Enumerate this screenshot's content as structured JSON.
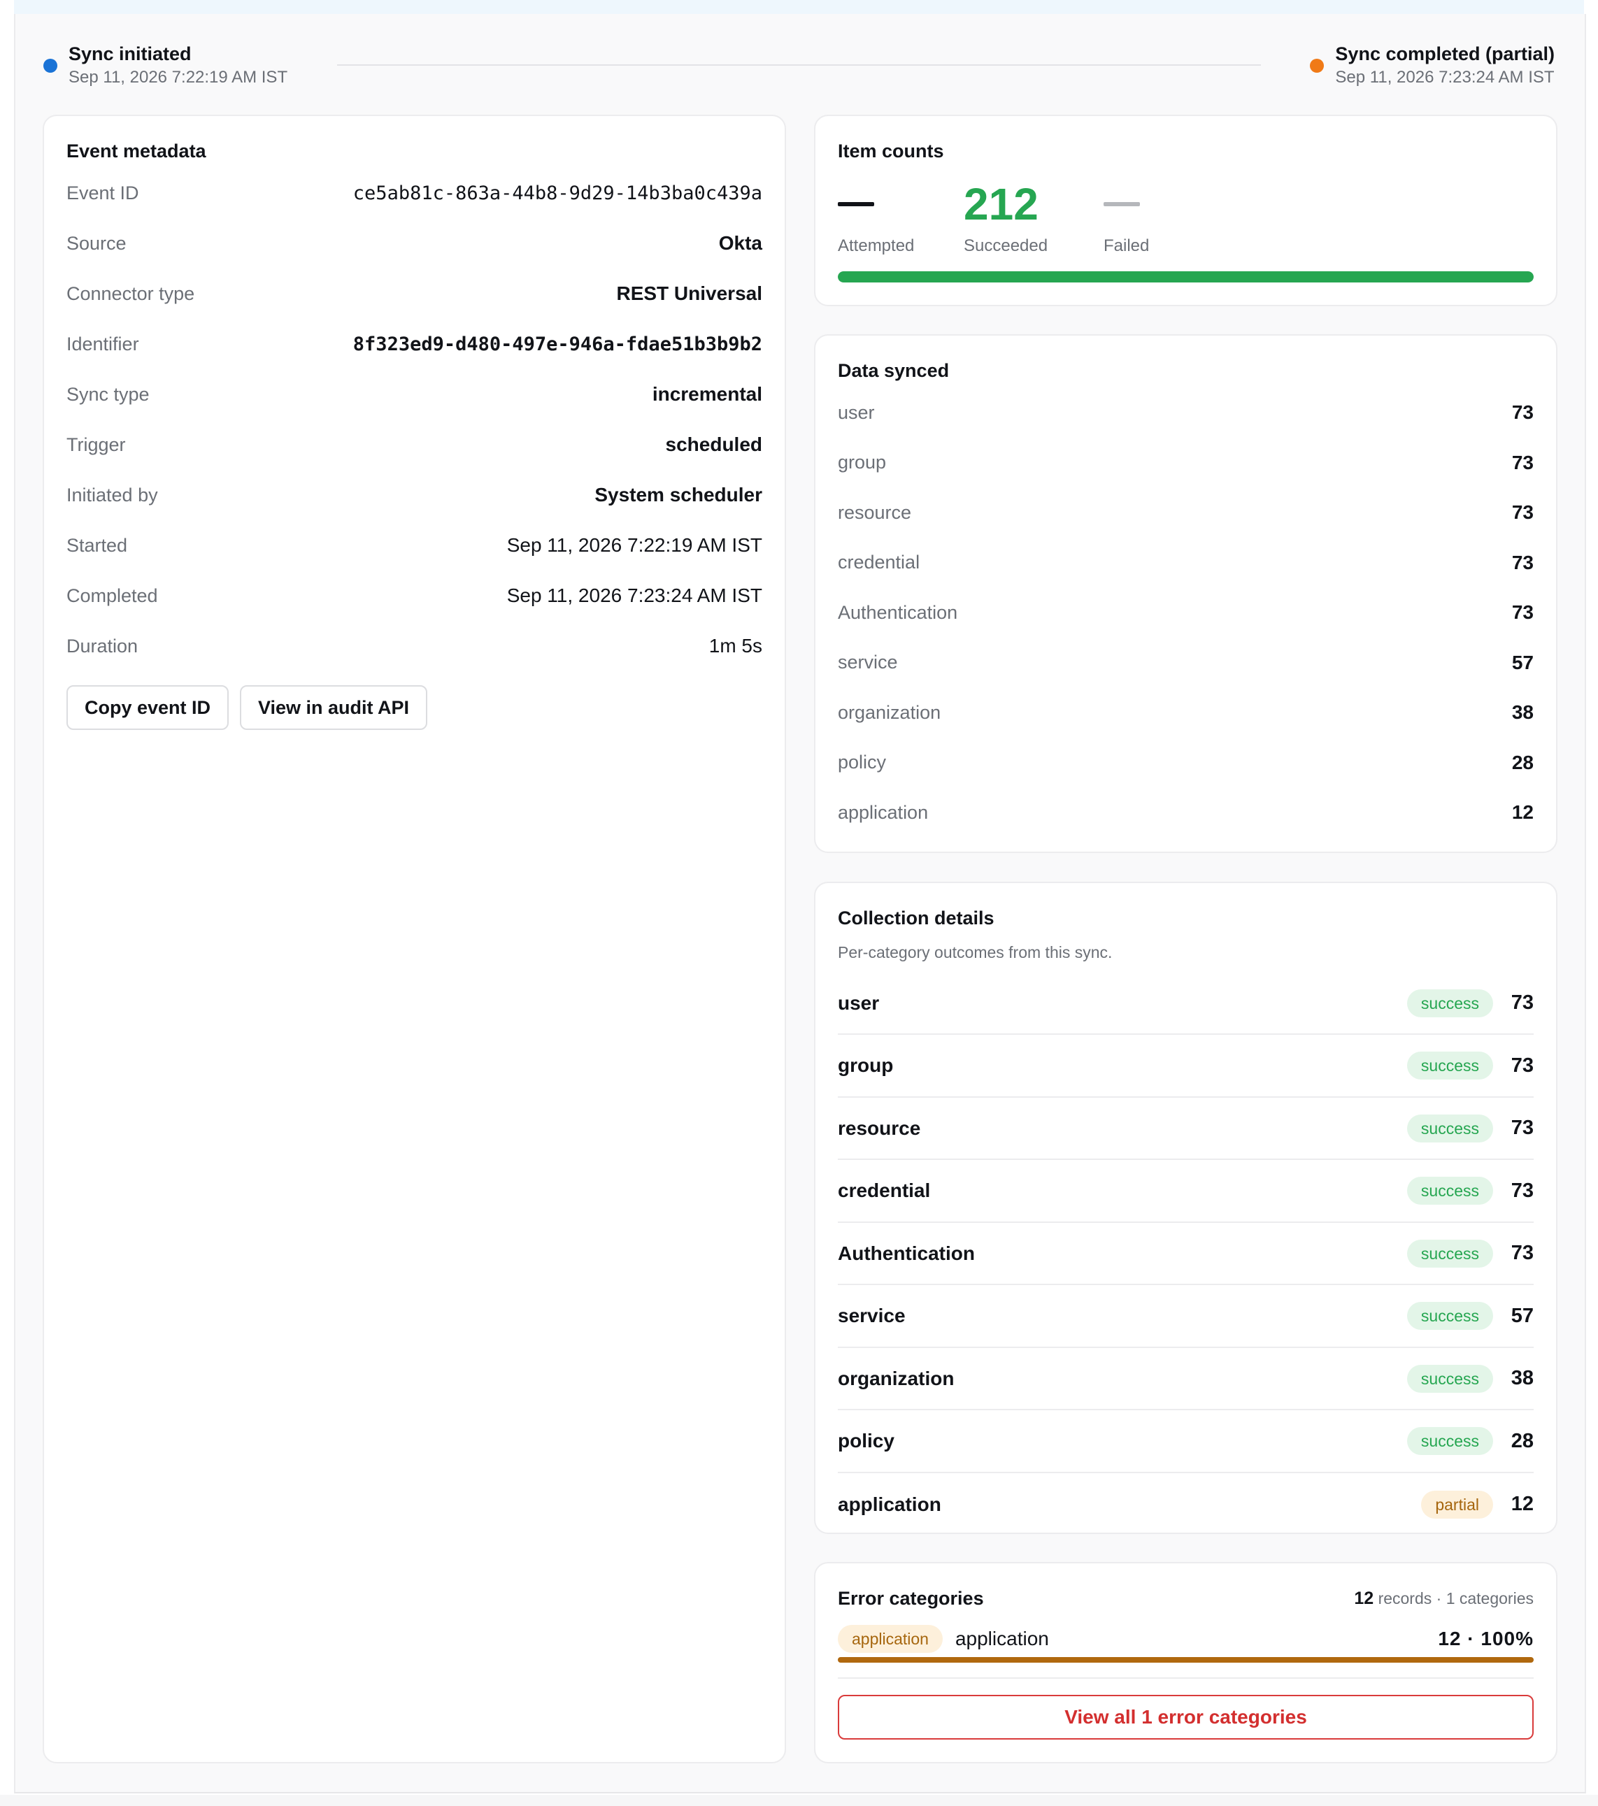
{
  "timeline": {
    "start": {
      "title": "Sync initiated",
      "time": "Sep 11, 2026 7:22:19 AM IST",
      "color": "#1a73d6"
    },
    "end": {
      "title": "Sync completed (partial)",
      "time": "Sep 11, 2026 7:23:24 AM IST",
      "color": "#f07a17"
    }
  },
  "metadata": {
    "title": "Event metadata",
    "rows": [
      {
        "label": "Event ID",
        "value": "ce5ab81c-863a-44b8-9d29-14b3ba0c439a"
      },
      {
        "label": "Source",
        "value": "Okta"
      },
      {
        "label": "Connector type",
        "value": "REST Universal"
      },
      {
        "label": "Identifier",
        "value": "8f323ed9-d480-497e-946a-fdae51b3b9b2"
      },
      {
        "label": "Sync type",
        "value": "incremental"
      },
      {
        "label": "Trigger",
        "value": "scheduled"
      },
      {
        "label": "Initiated by",
        "value": "System scheduler"
      },
      {
        "label": "Started",
        "value": "Sep 11, 2026 7:22:19 AM IST"
      },
      {
        "label": "Completed",
        "value": "Sep 11, 2026 7:23:24 AM IST"
      },
      {
        "label": "Duration",
        "value": "1m 5s"
      }
    ],
    "copy_button": "Copy event ID",
    "audit_button": "View in audit API"
  },
  "item_counts": {
    "title": "Item counts",
    "attempted": {
      "label": "Attempted",
      "value": "—"
    },
    "succeeded": {
      "label": "Succeeded",
      "value": "212"
    },
    "failed": {
      "label": "Failed",
      "value": "—"
    },
    "progress_fraction": 1.0,
    "success_color": "#26a651"
  },
  "data_synced": {
    "title": "Data synced",
    "rows": [
      {
        "label": "user",
        "value": "73"
      },
      {
        "label": "group",
        "value": "73"
      },
      {
        "label": "resource",
        "value": "73"
      },
      {
        "label": "credential",
        "value": "73"
      },
      {
        "label": "Authentication",
        "value": "73"
      },
      {
        "label": "service",
        "value": "57"
      },
      {
        "label": "organization",
        "value": "38"
      },
      {
        "label": "policy",
        "value": "28"
      },
      {
        "label": "application",
        "value": "12"
      }
    ]
  },
  "collection_details": {
    "title": "Collection details",
    "subtitle": "Per-category outcomes from this sync.",
    "rows": [
      {
        "label": "user",
        "status": "success",
        "value": "73"
      },
      {
        "label": "group",
        "status": "success",
        "value": "73"
      },
      {
        "label": "resource",
        "status": "success",
        "value": "73"
      },
      {
        "label": "credential",
        "status": "success",
        "value": "73"
      },
      {
        "label": "Authentication",
        "status": "success",
        "value": "73"
      },
      {
        "label": "service",
        "status": "success",
        "value": "57"
      },
      {
        "label": "organization",
        "status": "success",
        "value": "38"
      },
      {
        "label": "policy",
        "status": "success",
        "value": "28"
      },
      {
        "label": "application",
        "status": "partial",
        "value": "12"
      }
    ]
  },
  "error_categories": {
    "title": "Error categories",
    "records_count": "12",
    "records_text": "records · 1 categories",
    "items": [
      {
        "badge": "application",
        "name": "application",
        "value": "12 · 100%",
        "fraction": 1.0
      }
    ],
    "view_all_button": "View all 1 error categories",
    "bar_color": "#b0680e"
  }
}
